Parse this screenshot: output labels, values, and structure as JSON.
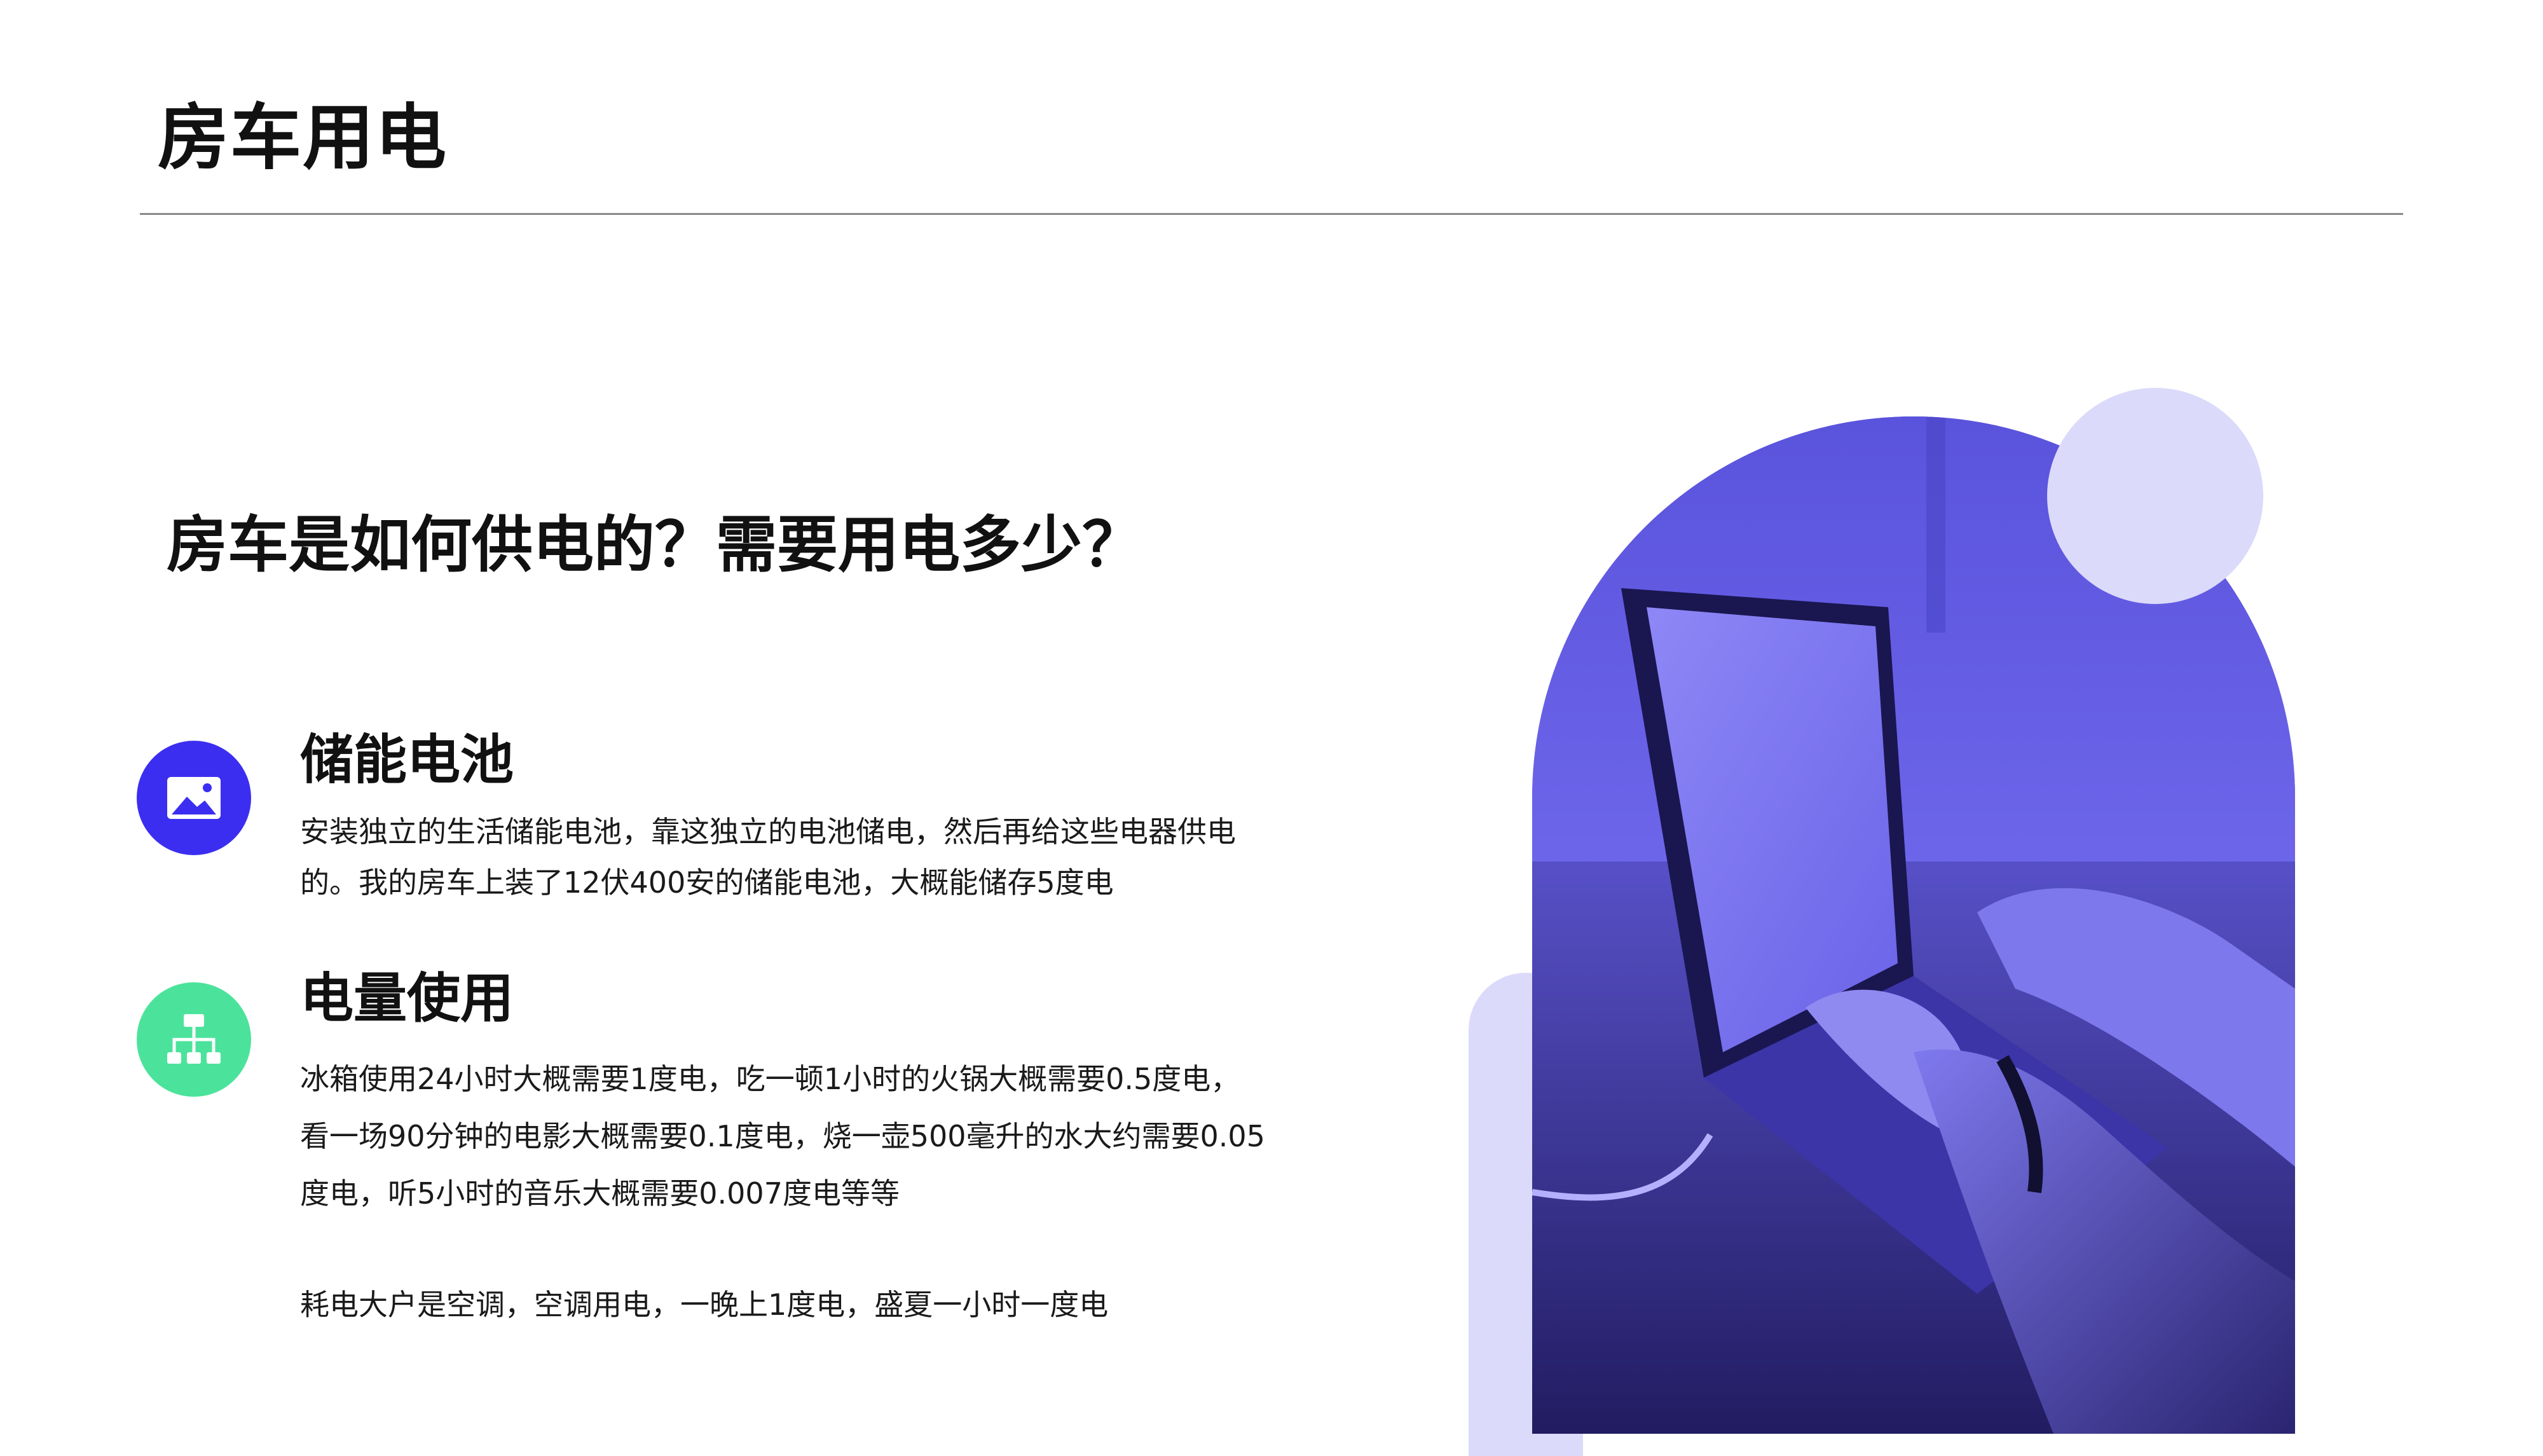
{
  "page": {
    "title": "房车用电",
    "subtitle": "房车是如何供电的？需要用电多少？"
  },
  "sections": [
    {
      "icon": "image-icon",
      "icon_color": "#3b2ef0",
      "heading": "储能电池",
      "lines": [
        "安装独立的生活储能电池，靠这独立的电池储电，然后再给这些电器供电",
        "的。我的房车上装了12伏400安的储能电池，大概能储存5度电"
      ]
    },
    {
      "icon": "sitemap-icon",
      "icon_color": "#4be39b",
      "heading": "电量使用",
      "lines": [
        "冰箱使用24小时大概需要1度电，吃一顿1小时的火锅大概需要0.5度电，",
        "看一场90分钟的电影大概需要0.1度电，烧一壶500毫升的水大约需要0.05",
        "度电，听5小时的音乐大概需要0.007度电等等"
      ],
      "note": "耗电大户是空调，空调用电，一晚上1度电，盛夏一小时一度电"
    }
  ],
  "visual": {
    "photo": "laptop-typing-photo",
    "tint_color": "#6b63e6",
    "accent_color": "#dcdafa"
  }
}
